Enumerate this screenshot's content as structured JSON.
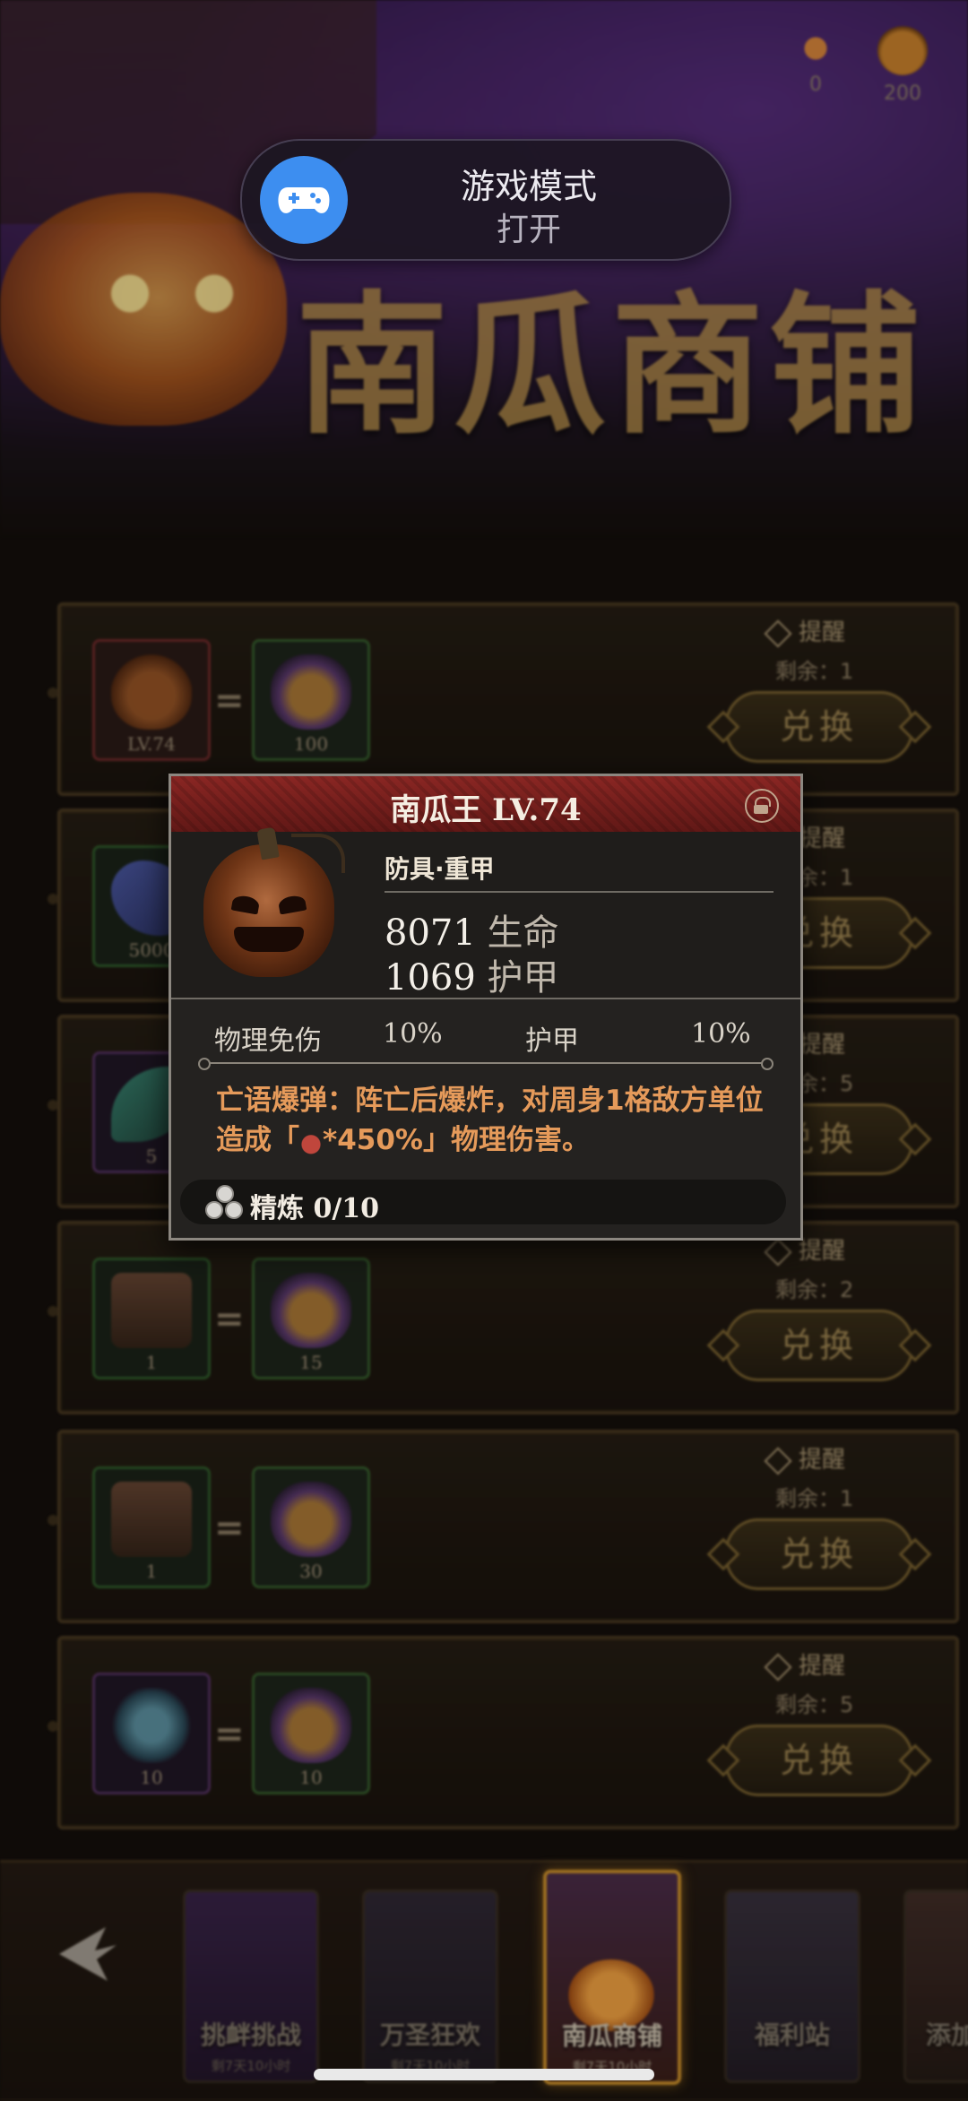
{
  "header": {
    "title": "南瓜商铺",
    "currencies": [
      {
        "icon": "candy-icon",
        "amount": "0"
      },
      {
        "icon": "pumpkin-coin-icon",
        "amount": "200"
      }
    ]
  },
  "notification": {
    "title": "游戏模式",
    "status": "打开",
    "icon": "gamepad-icon",
    "icon_color": "#3d8ef0"
  },
  "rows": [
    {
      "item_label": "LV.74",
      "cost": "100",
      "remind": "提醒",
      "remain": "剩余：1",
      "button": "兑换"
    },
    {
      "item_label": "5000",
      "cost": "",
      "remind": "提醒",
      "remain": "剩余：1",
      "button": "兑换"
    },
    {
      "item_label": "5",
      "cost": "",
      "remind": "提醒",
      "remain": "剩余：5",
      "button": "兑换"
    },
    {
      "item_label": "1",
      "cost": "15",
      "remind": "提醒",
      "remain": "剩余：2",
      "button": "兑换"
    },
    {
      "item_label": "1",
      "cost": "30",
      "remind": "提醒",
      "remain": "剩余：1",
      "button": "兑换"
    },
    {
      "item_label": "10",
      "cost": "10",
      "remind": "提醒",
      "remain": "剩余：5",
      "button": "兑换"
    }
  ],
  "tooltip": {
    "title": "南瓜王 LV.74",
    "type": "防具·重甲",
    "stats": [
      {
        "value": "8071",
        "label": "生命"
      },
      {
        "value": "1069",
        "label": "护甲"
      }
    ],
    "attributes": [
      {
        "label": "物理免伤",
        "value": "10%"
      },
      {
        "label": "护甲",
        "value": "10%"
      }
    ],
    "skill_part1": "亡语爆弹：阵亡后爆炸，对周身1格敌方单位造成「",
    "skill_part2": "*450%」物理伤害。",
    "refine": "精炼 0/10",
    "header_color": "#8a2623"
  },
  "tabs": [
    {
      "label": "挑衅挑战",
      "sub": "剩7天10小时"
    },
    {
      "label": "万圣狂欢",
      "sub": "剩7天10小时"
    },
    {
      "label": "南瓜商铺",
      "sub": "剩7天10小时",
      "active": true
    },
    {
      "label": "福利站",
      "sub": ""
    },
    {
      "label": "添加",
      "sub": ""
    }
  ]
}
